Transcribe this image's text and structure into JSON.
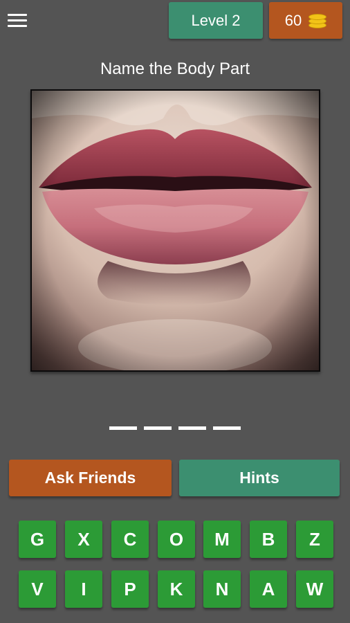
{
  "header": {
    "menu_icon": "hamburger-menu-icon",
    "level_label": "Level 2",
    "coins": "60",
    "coin_icon": "coin-stack-icon"
  },
  "question": {
    "prompt": "Name the Body Part"
  },
  "answer": {
    "slot_count": 4
  },
  "actions": {
    "ask_friends_label": "Ask Friends",
    "hints_label": "Hints"
  },
  "keyboard": {
    "row1": [
      "G",
      "X",
      "C",
      "O",
      "M",
      "B",
      "Z"
    ],
    "row2": [
      "V",
      "I",
      "P",
      "K",
      "N",
      "A",
      "W"
    ]
  },
  "colors": {
    "background": "#545454",
    "green_accent": "#3c8f70",
    "orange_accent": "#b4561f",
    "key_green": "#2c9b36",
    "coin_gold": "#f2c318"
  }
}
